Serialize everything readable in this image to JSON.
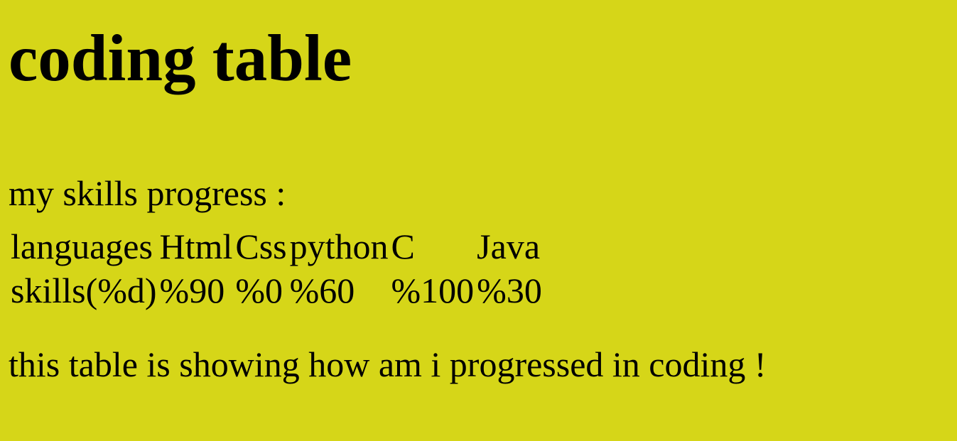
{
  "heading": "coding table",
  "caption": "my skills progress :",
  "table": {
    "columns": [
      "languages",
      "Html",
      "Css",
      "python",
      "C",
      "Java"
    ],
    "row": [
      "skills(%d)",
      "%90",
      "%0",
      "%60",
      "%100",
      "%30"
    ]
  },
  "footer": "this table is showing how am i progressed in coding !",
  "colors": {
    "background": "#d6d618",
    "text": "#000000"
  }
}
